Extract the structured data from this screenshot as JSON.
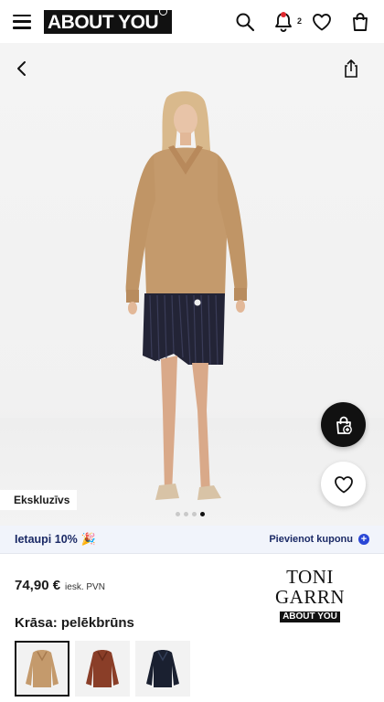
{
  "header": {
    "logo_text": "ABOUT YOU",
    "logo_mark": "°",
    "notification_count": "2",
    "icons": [
      "menu-icon",
      "search-icon",
      "bell-icon",
      "heart-icon",
      "bag-icon"
    ]
  },
  "gallery": {
    "badge": "Ekskluzīvs",
    "page_count": 4,
    "active_page": 4
  },
  "coupon": {
    "save_text": "Ietaupi 10%",
    "emoji": "🎉",
    "add_text": "Pievienot kuponu",
    "text_color": "#1b2a66",
    "accent_color": "#2a47d6"
  },
  "product": {
    "price": "74,90 €",
    "vat_note": "iesk. PVN",
    "brand_name": "TONI GARRN",
    "brand_sub": "ABOUT YOU",
    "color_label": "Krāsa: pelēkbrūns",
    "swatches": [
      {
        "color": "#c49a6c",
        "selected": true
      },
      {
        "color": "#8a3e28",
        "selected": false
      },
      {
        "color": "#1a2030",
        "selected": false
      }
    ]
  }
}
